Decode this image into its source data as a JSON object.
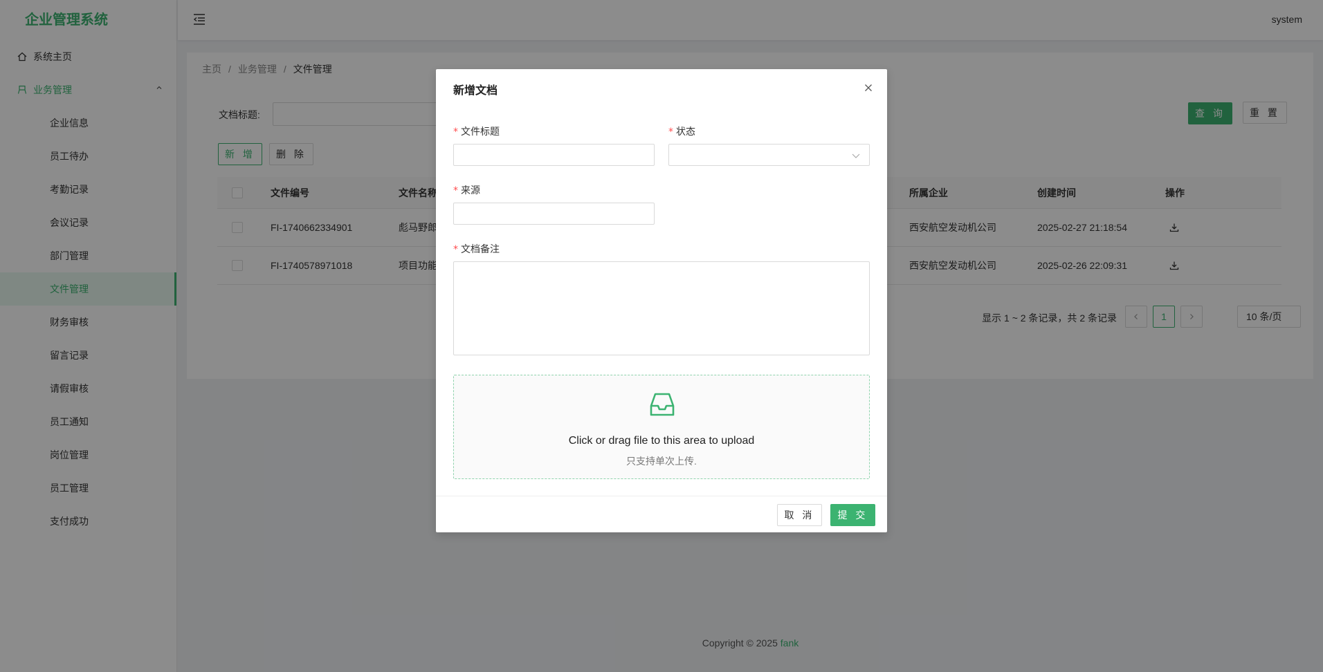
{
  "app": {
    "title": "企业管理系统",
    "user": "system"
  },
  "sidebar": {
    "home": "系统主页",
    "group": "业务管理",
    "items": [
      "企业信息",
      "员工待办",
      "考勤记录",
      "会议记录",
      "部门管理",
      "文件管理",
      "财务审核",
      "留言记录",
      "请假审核",
      "员工通知",
      "岗位管理",
      "员工管理",
      "支付成功"
    ],
    "active": "文件管理"
  },
  "breadcrumb": [
    "主页",
    "业务管理",
    "文件管理"
  ],
  "search": {
    "label": "文档标题:",
    "value": "",
    "query_button": "查 询",
    "reset_button": "重 置"
  },
  "toolbar": {
    "add_button": "新 增",
    "delete_button": "删 除"
  },
  "table": {
    "columns": [
      "文件编号",
      "文件名称",
      "所属企业",
      "创建时间",
      "操作"
    ],
    "rows": [
      {
        "id": "FI-1740662334901",
        "name": "彪马野郎",
        "company": "西安航空发动机公司",
        "created": "2025-02-27 21:18:54"
      },
      {
        "id": "FI-1740578971018",
        "name": "项目功能",
        "company": "西安航空发动机公司",
        "created": "2025-02-26 22:09:31"
      }
    ]
  },
  "pagination": {
    "summary": "显示 1 ~ 2 条记录，共 2 条记录",
    "current_page": "1",
    "page_size": "10 条/页"
  },
  "footer": {
    "copyright": "Copyright © 2025 ",
    "author": "fank"
  },
  "modal": {
    "title": "新增文档",
    "fields": {
      "title_label": "文件标题",
      "status_label": "状态",
      "source_label": "来源",
      "remark_label": "文档备注"
    },
    "upload": {
      "text": "Click or drag file to this area to upload",
      "hint": "只支持单次上传."
    },
    "cancel_button": "取 消",
    "submit_button": "提 交"
  },
  "colors": {
    "accent": "#3cb371",
    "required": "#ff4d4f"
  },
  "icons": [
    "home-icon",
    "business-icon",
    "chevron-up-icon",
    "menu-fold-icon",
    "download-icon",
    "close-icon",
    "chevron-down-icon",
    "inbox-icon",
    "left-arrow-icon",
    "right-arrow-icon"
  ]
}
